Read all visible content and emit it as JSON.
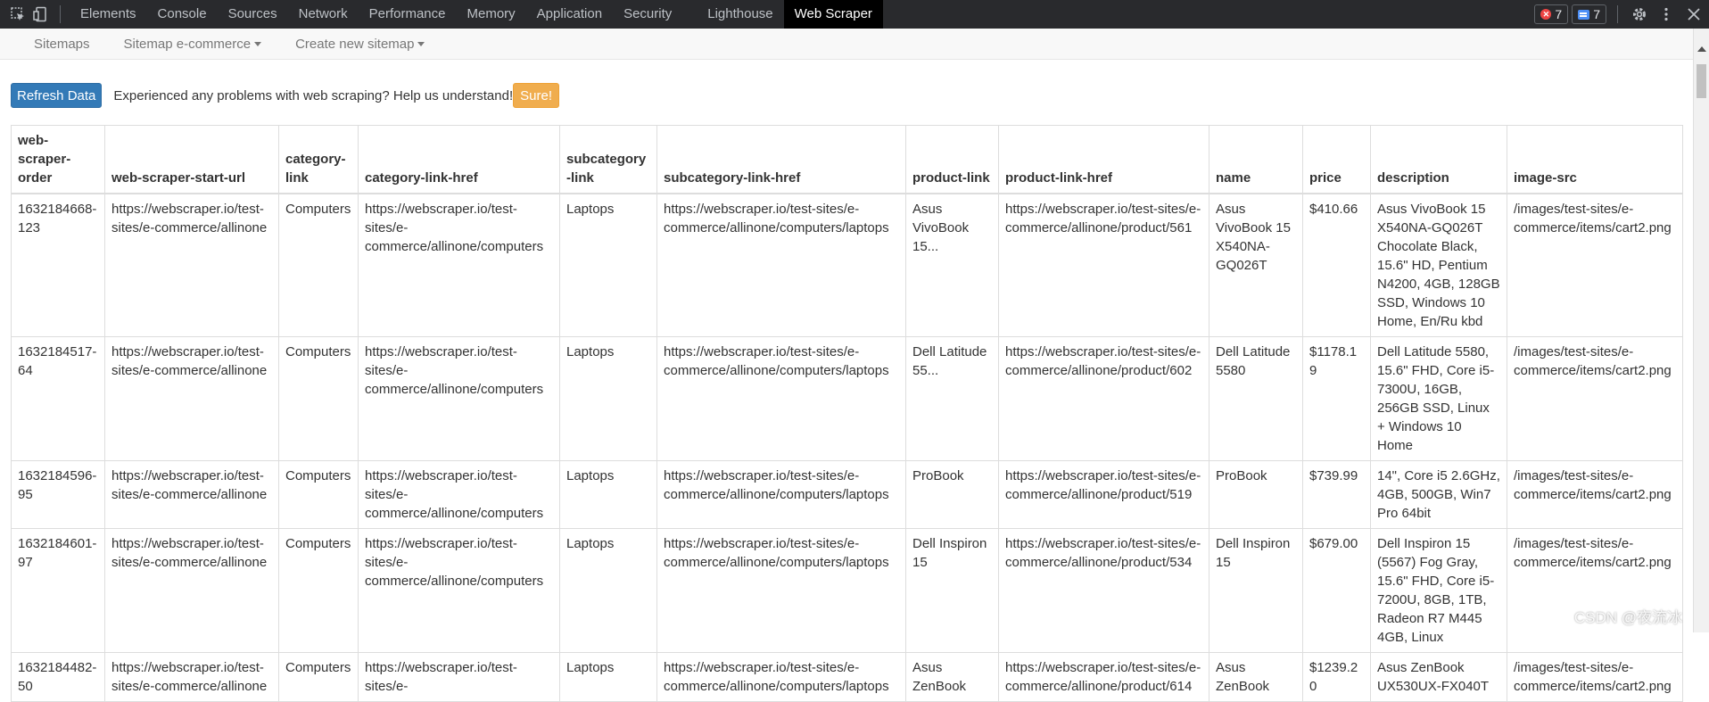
{
  "devtools": {
    "tabs": [
      {
        "label": "Elements"
      },
      {
        "label": "Console"
      },
      {
        "label": "Sources"
      },
      {
        "label": "Network"
      },
      {
        "label": "Performance"
      },
      {
        "label": "Memory"
      },
      {
        "label": "Application"
      },
      {
        "label": "Security"
      },
      {
        "label": "Lighthouse"
      },
      {
        "label": "Web Scraper"
      }
    ],
    "active_tab": "Web Scraper",
    "error_count": "7",
    "message_count": "7"
  },
  "scraper_nav": {
    "sitemaps": "Sitemaps",
    "sitemap_name": "Sitemap e-commerce",
    "create_new": "Create new sitemap"
  },
  "toolbar": {
    "refresh_label": "Refresh Data",
    "notice": "Experienced any problems with web scraping? Help us understand!",
    "sure_label": "Sure!"
  },
  "table": {
    "headers": [
      "web-scraper-order",
      "web-scraper-start-url",
      "category-link",
      "category-link-href",
      "subcategory-link",
      "subcategory-link-href",
      "product-link",
      "product-link-href",
      "name",
      "price",
      "description",
      "image-src"
    ],
    "rows": [
      [
        "1632184668-123",
        "https://webscraper.io/test-sites/e-commerce/allinone",
        "Computers",
        "https://webscraper.io/test-sites/e-commerce/allinone/computers",
        "Laptops",
        "https://webscraper.io/test-sites/e-commerce/allinone/computers/laptops",
        "Asus VivoBook 15...",
        "https://webscraper.io/test-sites/e-commerce/allinone/product/561",
        "Asus VivoBook 15 X540NA-GQ026T",
        "$410.66",
        "Asus VivoBook 15 X540NA-GQ026T Chocolate Black, 15.6\" HD, Pentium N4200, 4GB, 128GB SSD, Windows 10 Home, En/Ru kbd",
        "/images/test-sites/e-commerce/items/cart2.png"
      ],
      [
        "1632184517-64",
        "https://webscraper.io/test-sites/e-commerce/allinone",
        "Computers",
        "https://webscraper.io/test-sites/e-commerce/allinone/computers",
        "Laptops",
        "https://webscraper.io/test-sites/e-commerce/allinone/computers/laptops",
        "Dell Latitude 55...",
        "https://webscraper.io/test-sites/e-commerce/allinone/product/602",
        "Dell Latitude 5580",
        "$1178.19",
        "Dell Latitude 5580, 15.6\" FHD, Core i5-7300U, 16GB, 256GB SSD, Linux + Windows 10 Home",
        "/images/test-sites/e-commerce/items/cart2.png"
      ],
      [
        "1632184596-95",
        "https://webscraper.io/test-sites/e-commerce/allinone",
        "Computers",
        "https://webscraper.io/test-sites/e-commerce/allinone/computers",
        "Laptops",
        "https://webscraper.io/test-sites/e-commerce/allinone/computers/laptops",
        "ProBook",
        "https://webscraper.io/test-sites/e-commerce/allinone/product/519",
        "ProBook",
        "$739.99",
        "14\", Core i5 2.6GHz, 4GB, 500GB, Win7 Pro 64bit",
        "/images/test-sites/e-commerce/items/cart2.png"
      ],
      [
        "1632184601-97",
        "https://webscraper.io/test-sites/e-commerce/allinone",
        "Computers",
        "https://webscraper.io/test-sites/e-commerce/allinone/computers",
        "Laptops",
        "https://webscraper.io/test-sites/e-commerce/allinone/computers/laptops",
        "Dell Inspiron 15",
        "https://webscraper.io/test-sites/e-commerce/allinone/product/534",
        "Dell Inspiron 15",
        "$679.00",
        "Dell Inspiron 15 (5567) Fog Gray, 15.6\" FHD, Core i5-7200U, 8GB, 1TB, Radeon R7 M445 4GB, Linux",
        "/images/test-sites/e-commerce/items/cart2.png"
      ],
      [
        "1632184482-50",
        "https://webscraper.io/test-sites/e-commerce/allinone",
        "Computers",
        "https://webscraper.io/test-sites/e-",
        "Laptops",
        "https://webscraper.io/test-sites/e-commerce/allinone/computers/laptops",
        "Asus ZenBook",
        "https://webscraper.io/test-sites/e-commerce/allinone/product/614",
        "Asus ZenBook",
        "$1239.20",
        "Asus ZenBook UX530UX-FX040T",
        "/images/test-sites/e-commerce/items/cart2.png"
      ]
    ]
  },
  "watermark": "CSDN @夜流冰"
}
